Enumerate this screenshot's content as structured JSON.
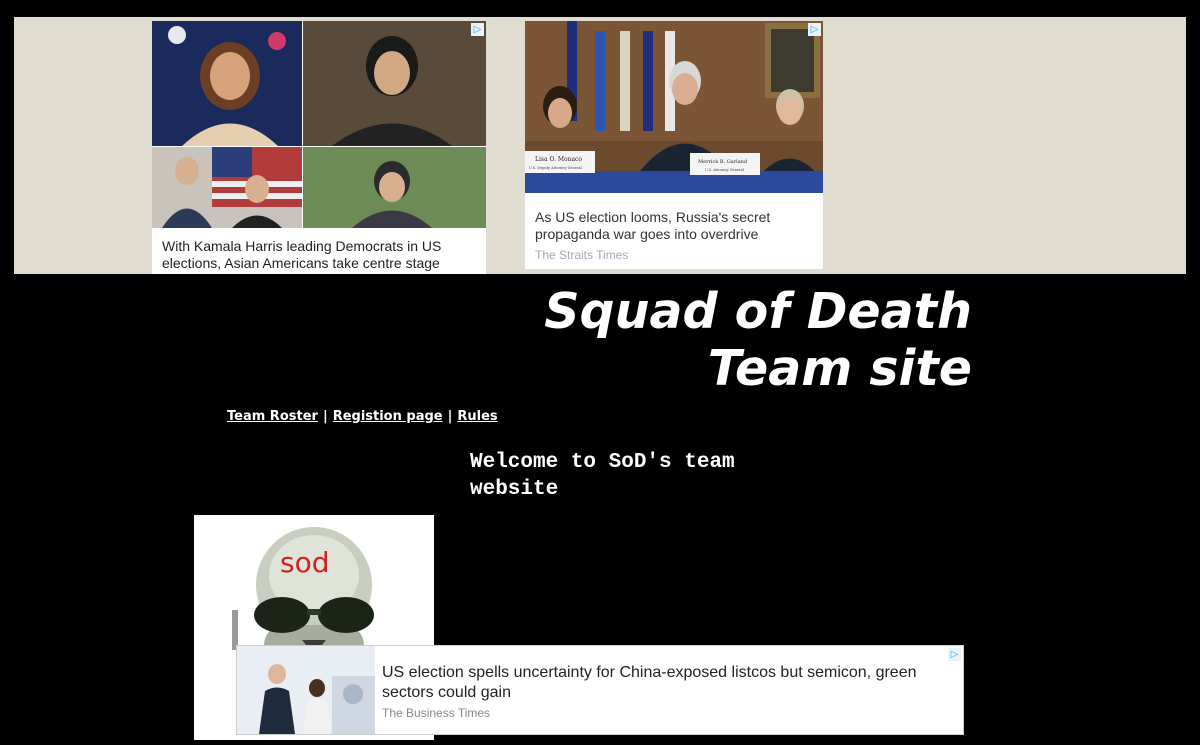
{
  "ads": {
    "card1": {
      "caption": "With Kamala Harris leading Democrats in US elections, Asian Americans take centre stage"
    },
    "card2": {
      "caption": "As US election looms, Russia's secret propaganda war goes into overdrive",
      "source": "The Straits Times",
      "placard_left": "Lisa O. Monaco",
      "placard_left_sub": "U.S. Deputy Attorney General",
      "placard_right": "Merrick B. Garland",
      "placard_right_sub": "U.S. Attorney General"
    },
    "bottom": {
      "headline": "US election spells uncertainty for China-exposed listcos but semicon, green sectors could gain",
      "source": "The Business Times"
    },
    "choices_icon": "ad-choices-icon"
  },
  "site": {
    "title_line1": "Squad of Death",
    "title_line2": "Team site",
    "nav": [
      "Team Roster",
      "Registion page",
      "Rules"
    ],
    "nav_separator": "|",
    "welcome": "Welcome to SoD's team website",
    "logo_text": "sod"
  }
}
